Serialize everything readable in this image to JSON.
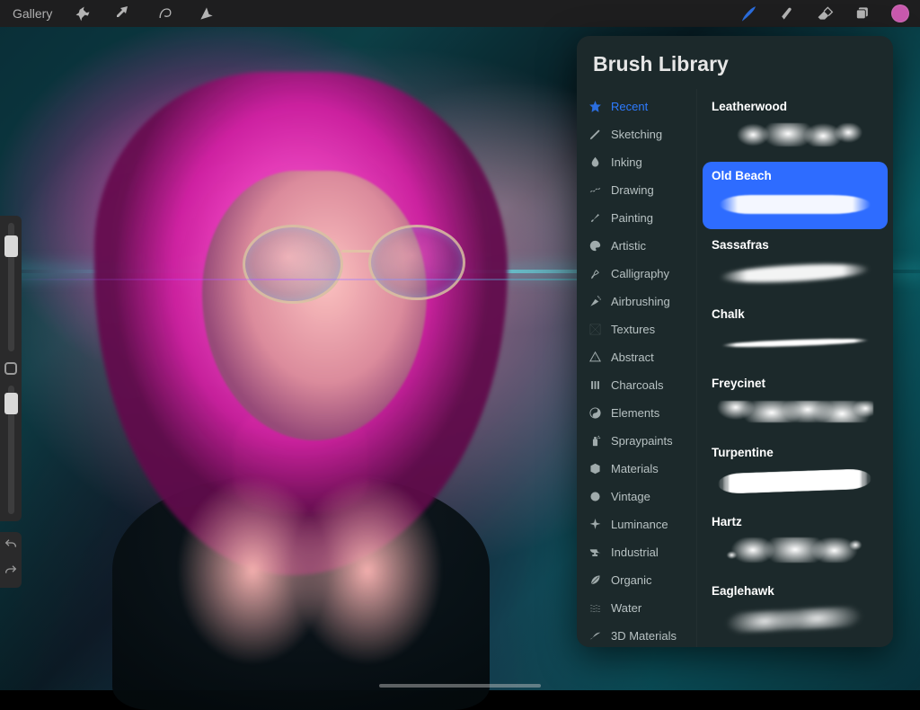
{
  "topbar": {
    "gallery_label": "Gallery"
  },
  "colors": {
    "accent": "#2e7bff",
    "swatch": "#e764c7",
    "popover_bg": "#1c292b",
    "selected_brush_bg": "#2e6cff"
  },
  "brush_library": {
    "title": "Brush Library",
    "active_category": "Recent",
    "selected_brush": "Old Beach",
    "categories": [
      {
        "label": "Recent",
        "icon": "star-icon"
      },
      {
        "label": "Sketching",
        "icon": "pencil-icon"
      },
      {
        "label": "Inking",
        "icon": "droplet-icon"
      },
      {
        "label": "Drawing",
        "icon": "squiggle-icon"
      },
      {
        "label": "Painting",
        "icon": "brush-icon"
      },
      {
        "label": "Artistic",
        "icon": "palette-icon"
      },
      {
        "label": "Calligraphy",
        "icon": "calligraphy-icon"
      },
      {
        "label": "Airbrushing",
        "icon": "airbrush-icon"
      },
      {
        "label": "Textures",
        "icon": "texture-icon"
      },
      {
        "label": "Abstract",
        "icon": "abstract-icon"
      },
      {
        "label": "Charcoals",
        "icon": "charcoal-icon"
      },
      {
        "label": "Elements",
        "icon": "yinyang-icon"
      },
      {
        "label": "Spraypaints",
        "icon": "spray-icon"
      },
      {
        "label": "Materials",
        "icon": "cube-icon"
      },
      {
        "label": "Vintage",
        "icon": "badge-icon"
      },
      {
        "label": "Luminance",
        "icon": "sparkle-icon"
      },
      {
        "label": "Industrial",
        "icon": "anvil-icon"
      },
      {
        "label": "Organic",
        "icon": "leaf-icon"
      },
      {
        "label": "Water",
        "icon": "waves-icon"
      },
      {
        "label": "3D Materials",
        "icon": "curve-icon"
      }
    ],
    "brushes": [
      {
        "name": "Leatherwood",
        "stroke_style": "sk-cloud"
      },
      {
        "name": "Old Beach",
        "stroke_style": "sk-wash"
      },
      {
        "name": "Sassafras",
        "stroke_style": "sk-soft"
      },
      {
        "name": "Chalk",
        "stroke_style": "sk-thin"
      },
      {
        "name": "Freycinet",
        "stroke_style": "sk-rough"
      },
      {
        "name": "Turpentine",
        "stroke_style": "sk-dry"
      },
      {
        "name": "Hartz",
        "stroke_style": "sk-spatter"
      },
      {
        "name": "Eaglehawk",
        "stroke_style": "sk-smoke"
      }
    ]
  }
}
